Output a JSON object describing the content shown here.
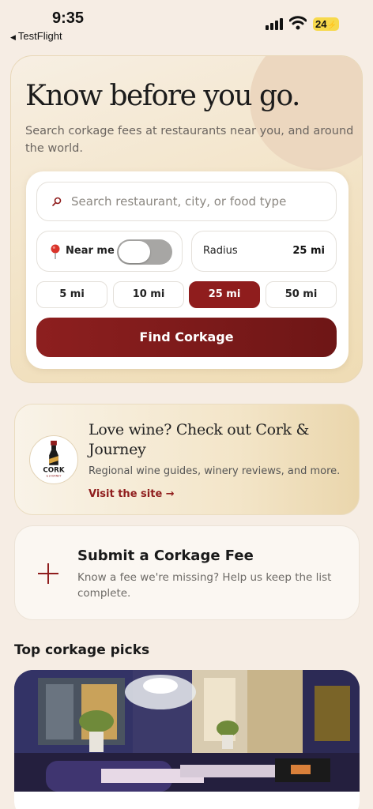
{
  "status_bar": {
    "time": "9:35",
    "back_app": "TestFlight",
    "battery": "24"
  },
  "hero": {
    "title": "Know before you go.",
    "subtitle": "Search corkage fees at restaurants near you, and around the world.",
    "search_placeholder": "Search restaurant, city, or food type",
    "near_me_label": "Near me",
    "near_me_on": false,
    "radius_label": "Radius",
    "radius_value": "25 mi",
    "radius_options": [
      "5 mi",
      "10 mi",
      "25 mi",
      "50 mi"
    ],
    "radius_selected": "25 mi",
    "find_button": "Find Corkage"
  },
  "promo": {
    "logo_text": "CORK",
    "logo_subtext": "& JOURNEY",
    "title": "Love wine? Check out Cork & Journey",
    "subtitle": "Regional wine guides, winery reviews, and more.",
    "link": "Visit the site →"
  },
  "submit": {
    "title": "Submit a Corkage Fee",
    "subtitle": "Know a fee we're missing? Help us keep the list complete."
  },
  "top_picks": {
    "heading": "Top corkage picks"
  },
  "colors": {
    "accent": "#8f1d1d",
    "background": "#f6ede4",
    "toggle_off": "#a7a6a4",
    "battery": "#f7d94c"
  }
}
